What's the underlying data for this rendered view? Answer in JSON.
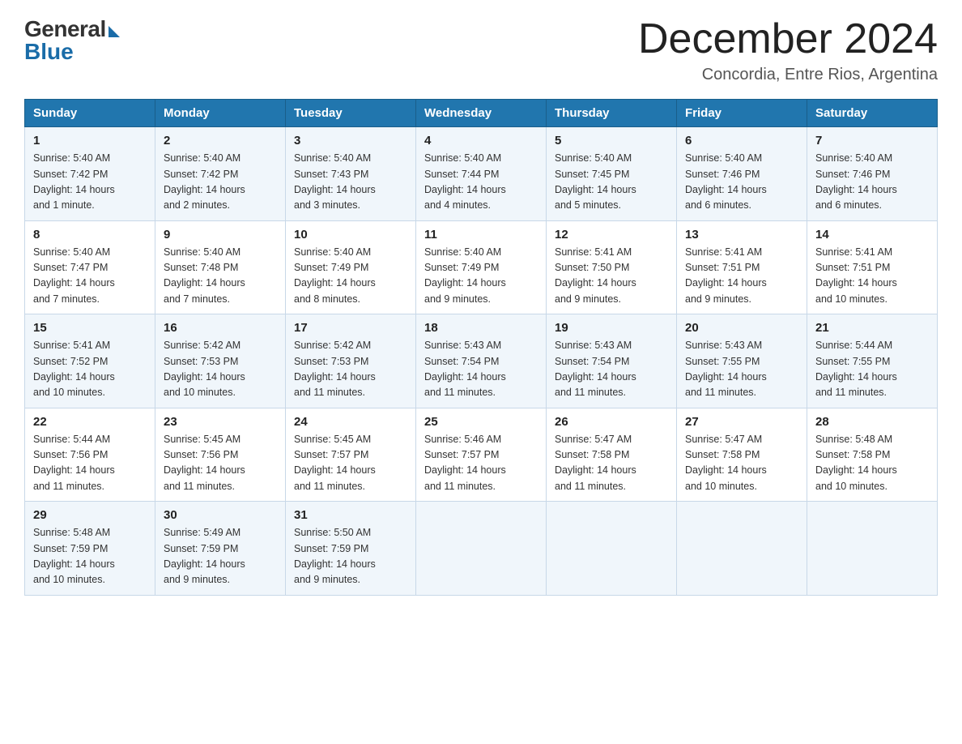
{
  "logo": {
    "general": "General",
    "blue": "Blue"
  },
  "header": {
    "month_year": "December 2024",
    "location": "Concordia, Entre Rios, Argentina"
  },
  "days_of_week": [
    "Sunday",
    "Monday",
    "Tuesday",
    "Wednesday",
    "Thursday",
    "Friday",
    "Saturday"
  ],
  "weeks": [
    [
      {
        "day": "1",
        "sunrise": "5:40 AM",
        "sunset": "7:42 PM",
        "daylight": "14 hours and 1 minute."
      },
      {
        "day": "2",
        "sunrise": "5:40 AM",
        "sunset": "7:42 PM",
        "daylight": "14 hours and 2 minutes."
      },
      {
        "day": "3",
        "sunrise": "5:40 AM",
        "sunset": "7:43 PM",
        "daylight": "14 hours and 3 minutes."
      },
      {
        "day": "4",
        "sunrise": "5:40 AM",
        "sunset": "7:44 PM",
        "daylight": "14 hours and 4 minutes."
      },
      {
        "day": "5",
        "sunrise": "5:40 AM",
        "sunset": "7:45 PM",
        "daylight": "14 hours and 5 minutes."
      },
      {
        "day": "6",
        "sunrise": "5:40 AM",
        "sunset": "7:46 PM",
        "daylight": "14 hours and 6 minutes."
      },
      {
        "day": "7",
        "sunrise": "5:40 AM",
        "sunset": "7:46 PM",
        "daylight": "14 hours and 6 minutes."
      }
    ],
    [
      {
        "day": "8",
        "sunrise": "5:40 AM",
        "sunset": "7:47 PM",
        "daylight": "14 hours and 7 minutes."
      },
      {
        "day": "9",
        "sunrise": "5:40 AM",
        "sunset": "7:48 PM",
        "daylight": "14 hours and 7 minutes."
      },
      {
        "day": "10",
        "sunrise": "5:40 AM",
        "sunset": "7:49 PM",
        "daylight": "14 hours and 8 minutes."
      },
      {
        "day": "11",
        "sunrise": "5:40 AM",
        "sunset": "7:49 PM",
        "daylight": "14 hours and 9 minutes."
      },
      {
        "day": "12",
        "sunrise": "5:41 AM",
        "sunset": "7:50 PM",
        "daylight": "14 hours and 9 minutes."
      },
      {
        "day": "13",
        "sunrise": "5:41 AM",
        "sunset": "7:51 PM",
        "daylight": "14 hours and 9 minutes."
      },
      {
        "day": "14",
        "sunrise": "5:41 AM",
        "sunset": "7:51 PM",
        "daylight": "14 hours and 10 minutes."
      }
    ],
    [
      {
        "day": "15",
        "sunrise": "5:41 AM",
        "sunset": "7:52 PM",
        "daylight": "14 hours and 10 minutes."
      },
      {
        "day": "16",
        "sunrise": "5:42 AM",
        "sunset": "7:53 PM",
        "daylight": "14 hours and 10 minutes."
      },
      {
        "day": "17",
        "sunrise": "5:42 AM",
        "sunset": "7:53 PM",
        "daylight": "14 hours and 11 minutes."
      },
      {
        "day": "18",
        "sunrise": "5:43 AM",
        "sunset": "7:54 PM",
        "daylight": "14 hours and 11 minutes."
      },
      {
        "day": "19",
        "sunrise": "5:43 AM",
        "sunset": "7:54 PM",
        "daylight": "14 hours and 11 minutes."
      },
      {
        "day": "20",
        "sunrise": "5:43 AM",
        "sunset": "7:55 PM",
        "daylight": "14 hours and 11 minutes."
      },
      {
        "day": "21",
        "sunrise": "5:44 AM",
        "sunset": "7:55 PM",
        "daylight": "14 hours and 11 minutes."
      }
    ],
    [
      {
        "day": "22",
        "sunrise": "5:44 AM",
        "sunset": "7:56 PM",
        "daylight": "14 hours and 11 minutes."
      },
      {
        "day": "23",
        "sunrise": "5:45 AM",
        "sunset": "7:56 PM",
        "daylight": "14 hours and 11 minutes."
      },
      {
        "day": "24",
        "sunrise": "5:45 AM",
        "sunset": "7:57 PM",
        "daylight": "14 hours and 11 minutes."
      },
      {
        "day": "25",
        "sunrise": "5:46 AM",
        "sunset": "7:57 PM",
        "daylight": "14 hours and 11 minutes."
      },
      {
        "day": "26",
        "sunrise": "5:47 AM",
        "sunset": "7:58 PM",
        "daylight": "14 hours and 11 minutes."
      },
      {
        "day": "27",
        "sunrise": "5:47 AM",
        "sunset": "7:58 PM",
        "daylight": "14 hours and 10 minutes."
      },
      {
        "day": "28",
        "sunrise": "5:48 AM",
        "sunset": "7:58 PM",
        "daylight": "14 hours and 10 minutes."
      }
    ],
    [
      {
        "day": "29",
        "sunrise": "5:48 AM",
        "sunset": "7:59 PM",
        "daylight": "14 hours and 10 minutes."
      },
      {
        "day": "30",
        "sunrise": "5:49 AM",
        "sunset": "7:59 PM",
        "daylight": "14 hours and 9 minutes."
      },
      {
        "day": "31",
        "sunrise": "5:50 AM",
        "sunset": "7:59 PM",
        "daylight": "14 hours and 9 minutes."
      },
      null,
      null,
      null,
      null
    ]
  ],
  "labels": {
    "sunrise": "Sunrise:",
    "sunset": "Sunset:",
    "daylight": "Daylight:"
  }
}
